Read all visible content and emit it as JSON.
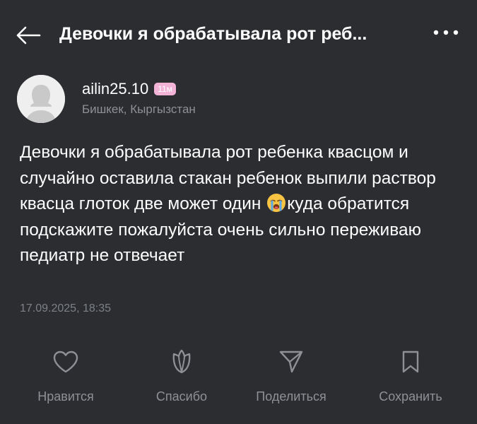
{
  "header": {
    "title": "Девочки я обрабатывала рот реб..."
  },
  "author": {
    "username": "ailin25.10",
    "badge": "11м",
    "location": "Бишкек, Кыргызстан"
  },
  "post": {
    "text_part1": "Девочки я обрабатывала рот ребенка квасцом и случайно оставила стакан ребенок выпили раствор квасца глоток две может один",
    "emoji_icon": "crying-face-emoji",
    "text_part2": "куда обратится подскажите пожалуйста очень сильно переживаю педиатр не отвечает",
    "timestamp": "17.09.2025, 18:35"
  },
  "actions": {
    "like_label": "Нравится",
    "thanks_label": "Спасибо",
    "share_label": "Поделиться",
    "save_label": "Сохранить"
  },
  "colors": {
    "background": "#2b2d31",
    "text": "#ffffff",
    "muted": "#8e9096",
    "badge": "#f3b3d6"
  }
}
